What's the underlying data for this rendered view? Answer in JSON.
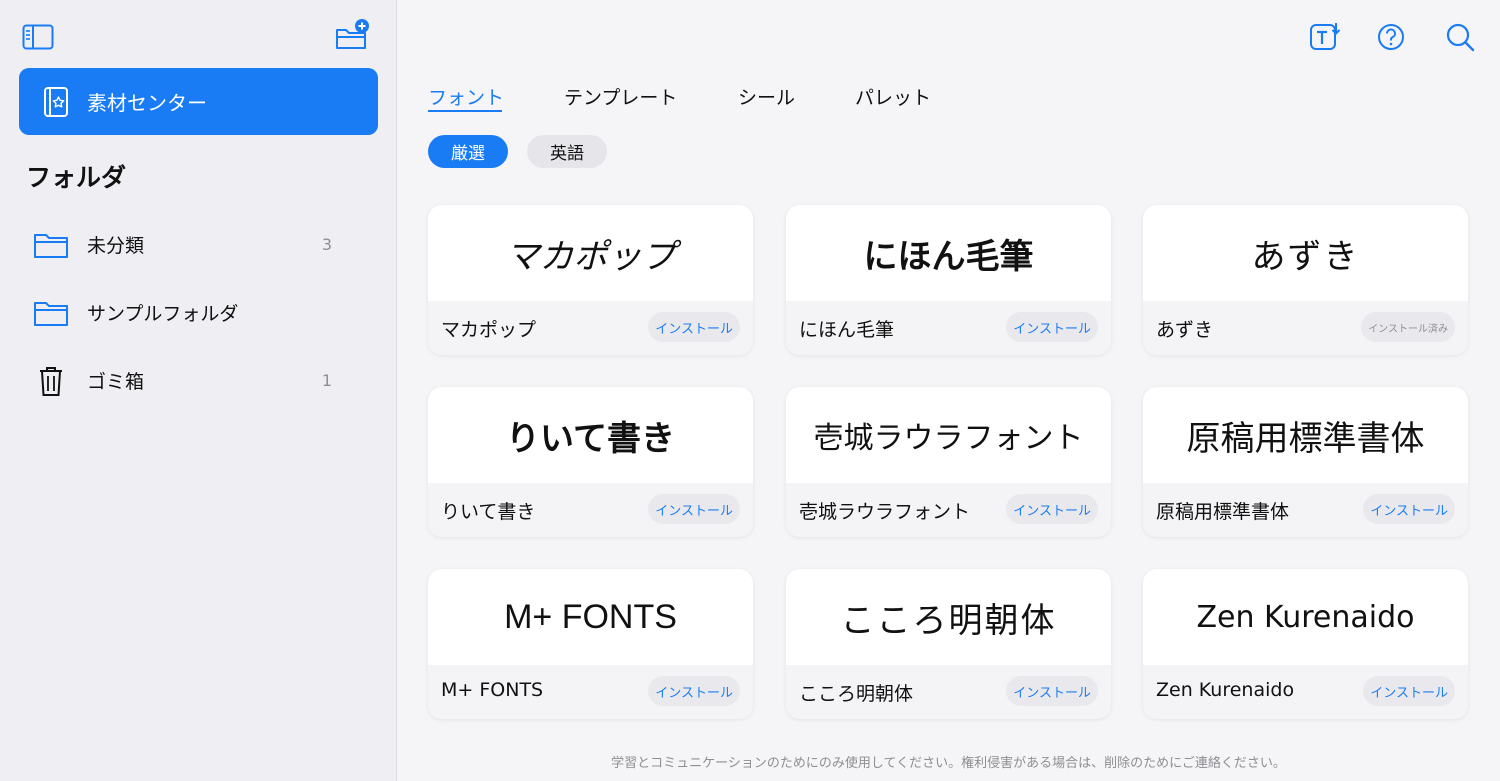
{
  "sidebar": {
    "material_center": "素材センター",
    "folders_heading": "フォルダ",
    "folders": [
      {
        "name": "未分類",
        "count": "3"
      },
      {
        "name": "サンプルフォルダ",
        "count": ""
      },
      {
        "name": "ゴミ箱",
        "count": "1"
      }
    ]
  },
  "tabs": [
    "フォント",
    "テンプレート",
    "シール",
    "パレット"
  ],
  "filters": [
    "厳選",
    "英語"
  ],
  "fonts": [
    {
      "preview": "マカポップ",
      "name": "マカポップ",
      "action": "インストール"
    },
    {
      "preview": "にほん毛筆",
      "name": "にほん毛筆",
      "action": "インストール"
    },
    {
      "preview": "あずき",
      "name": "あずき",
      "action": "インストール済み"
    },
    {
      "preview": "りいて書き",
      "name": "りいて書き",
      "action": "インストール"
    },
    {
      "preview": "壱城ラウラフォント",
      "name": "壱城ラウラフォント",
      "action": "インストール"
    },
    {
      "preview": "原稿用標準書体",
      "name": "原稿用標準書体",
      "action": "インストール"
    },
    {
      "preview": "M+ FONTS",
      "name": "M+ FONTS",
      "action": "インストール"
    },
    {
      "preview": "こころ明朝体",
      "name": "こころ明朝体",
      "action": "インストール"
    },
    {
      "preview": "Zen Kurenaido",
      "name": "Zen Kurenaido",
      "action": "インストール"
    }
  ],
  "footer_note": "学習とコミュニケーションのためにのみ使用してください。権利侵害がある場合は、削除のためにご連絡ください。",
  "icons": {
    "sidebar_toggle": "sidebar-icon",
    "new_folder": "folder-plus-icon",
    "material_center": "notebook-star-icon",
    "folder": "folder-icon",
    "trash": "trash-icon",
    "font_download": "text-download-icon",
    "help": "question-icon",
    "search": "search-icon"
  },
  "colors": {
    "accent": "#1a7cf5",
    "sidebar_bg": "#eeeef3",
    "main_bg": "#f5f5f7"
  }
}
